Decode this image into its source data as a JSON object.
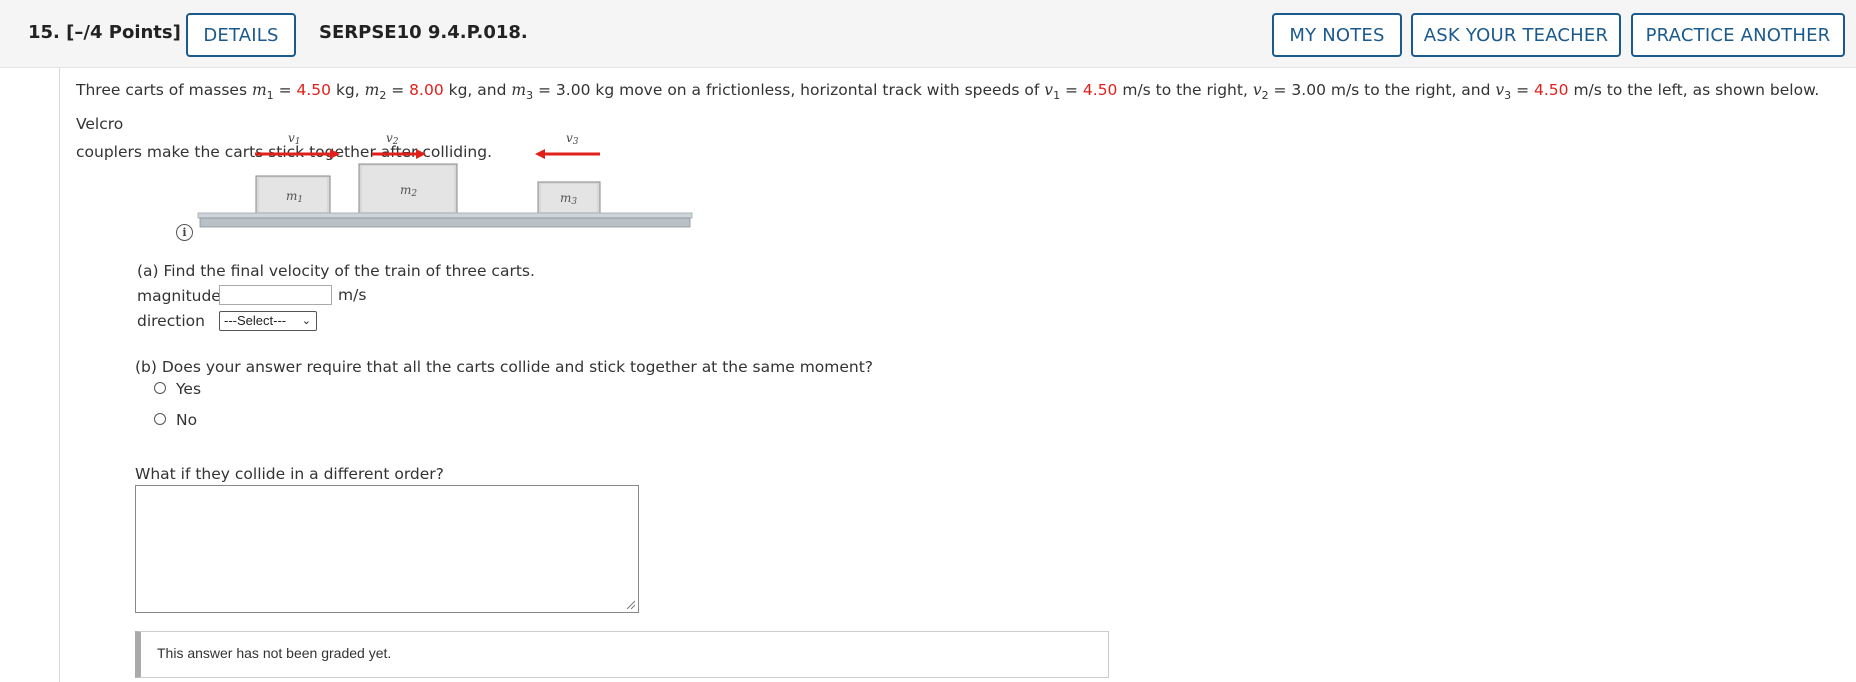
{
  "header": {
    "question_number": "15.",
    "points": "[–/4 Points]",
    "details_label": "DETAILS",
    "code": "SERPSE10 9.4.P.018.",
    "my_notes_label": "MY NOTES",
    "ask_teacher_label": "ASK YOUR TEACHER",
    "practice_label": "PRACTICE ANOTHER"
  },
  "problem": {
    "t1": "Three carts of masses ",
    "m1_var": "m",
    "m1_sub": "1",
    "eq": " = ",
    "m1_val": "4.50",
    "t2": " kg, ",
    "m2_var": "m",
    "m2_sub": "2",
    "m2_val": "8.00",
    "t3": " kg, and ",
    "m3_var": "m",
    "m3_sub": "3",
    "t4": " = 3.00 kg move on a frictionless, horizontal track with speeds of ",
    "v1_var": "v",
    "v1_sub": "1",
    "v1_val": "4.50",
    "t5": " m/s to the right, ",
    "v2_var": "v",
    "v2_sub": "2",
    "t6": " = 3.00 m/s to the right, and ",
    "v3_var": "v",
    "v3_sub": "3",
    "v3_val": "4.50",
    "t7": " m/s to the left, as shown below. Velcro",
    "t8": "couplers make the carts stick together after colliding."
  },
  "figure": {
    "v1": "v",
    "v1_sub": "1",
    "v2": "v",
    "v2_sub": "2",
    "v3": "v",
    "v3_sub": "3",
    "m1": "m",
    "m1_sub": "1",
    "m2": "m",
    "m2_sub": "2",
    "m3": "m",
    "m3_sub": "3",
    "info": "i"
  },
  "part_a": {
    "prompt": "(a) Find the final velocity of the train of three carts.",
    "magnitude_label": "magnitude",
    "magnitude_value": "",
    "unit": "m/s",
    "direction_label": "direction",
    "direction_value": "---Select---"
  },
  "part_b": {
    "prompt": "(b) Does your answer require that all the carts collide and stick together at the same moment?",
    "options": [
      "Yes",
      "No"
    ]
  },
  "what_if": {
    "prompt": "What if they collide in a different order?",
    "answer": ""
  },
  "status": {
    "message": "This answer has not been graded yet."
  },
  "colors": {
    "accent": "#1a5a8e",
    "highlight": "#e0201b",
    "arrow": "#e0201b"
  }
}
